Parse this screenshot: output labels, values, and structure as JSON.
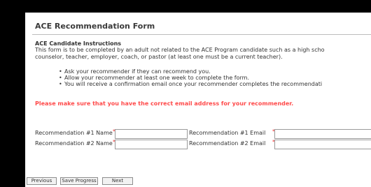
{
  "form": {
    "title": "ACE Recommendation Form",
    "instructions_title": "ACE Candidate Instructions",
    "intro_line1": "This form is to be completed by an adult not related to the ACE Program candidate such as a high scho",
    "intro_line2": "counselor, teacher, employer, coach, or pastor (at least one must be a current teacher).",
    "bullets": [
      "Ask your recommender if they can recommend you.",
      "Allow your recommender at least one week to complete the form.",
      "You will receive a confirmation email once your recommender completes the recommendati"
    ],
    "warning": "Please make sure that you have the correct email address for your recommender.",
    "required_mark": "*",
    "rec1_name_label": "Recommendation #1 Name",
    "rec1_email_label": "Recommendation #1 Email",
    "rec2_name_label": "Recommendation #2 Name",
    "rec2_email_label": "Recommendation #2 Email",
    "rec1_name_value": "",
    "rec1_email_value": "",
    "rec2_name_value": "",
    "rec2_email_value": ""
  },
  "buttons": {
    "previous": "Previous",
    "save": "Save Progress",
    "next": "Next"
  }
}
